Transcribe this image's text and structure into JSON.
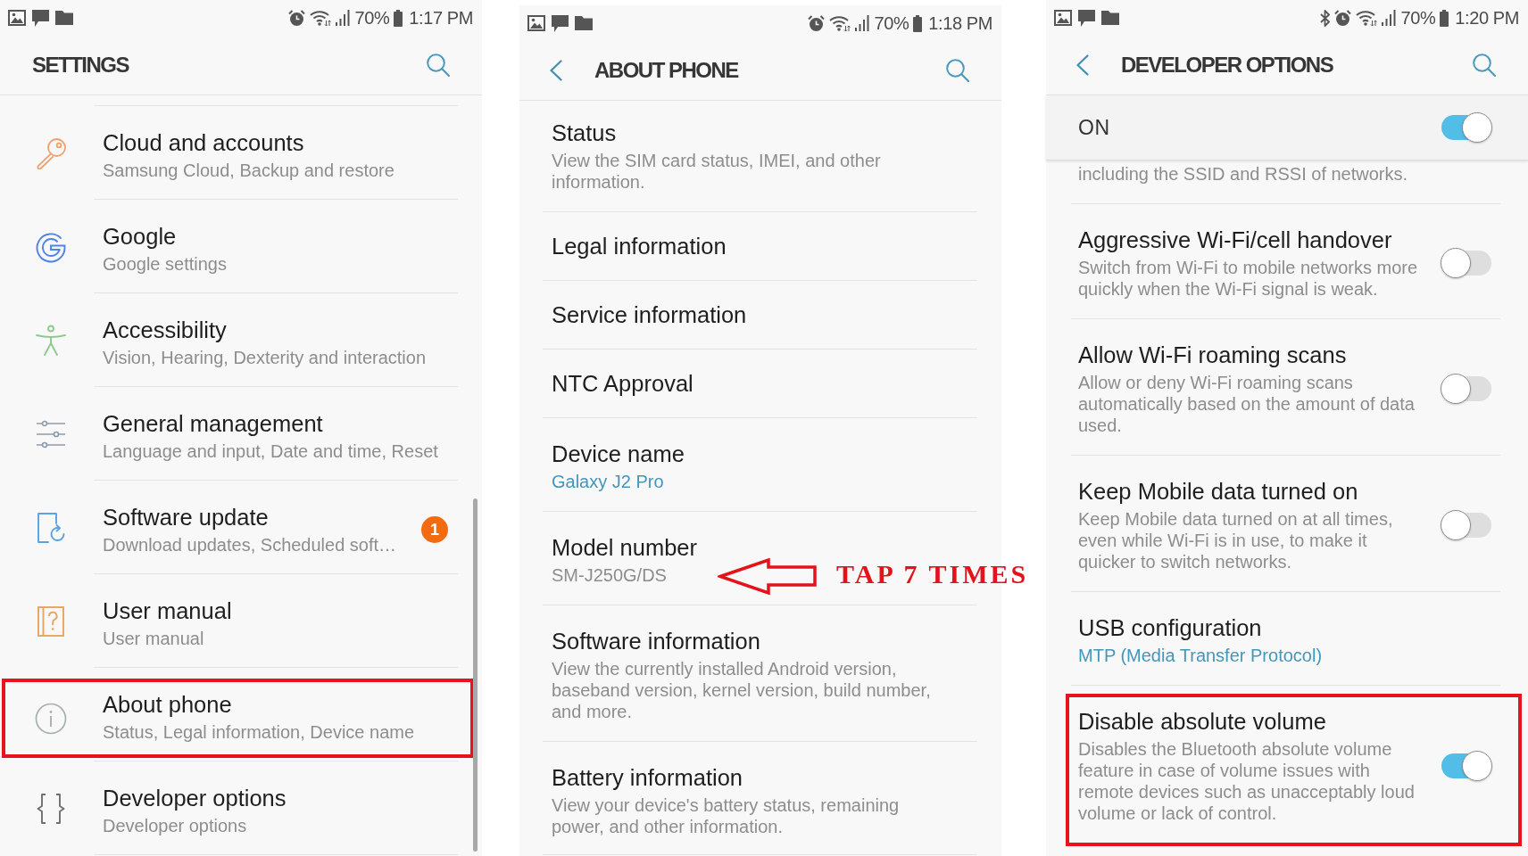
{
  "screens": [
    {
      "kind": "menu",
      "status_bar": {
        "bluetooth": false,
        "battery": "70%",
        "time": "1:17 PM"
      },
      "header": {
        "title": "SETTINGS",
        "back": false
      },
      "items": [
        {
          "title": "Cloud and accounts",
          "subtitle": "Samsung Cloud, Backup and restore",
          "highlighted": false
        },
        {
          "title": "Google",
          "subtitle": "Google settings",
          "highlighted": false
        },
        {
          "title": "Accessibility",
          "subtitle": "Vision, Hearing, Dexterity and interaction",
          "highlighted": false
        },
        {
          "title": "General management",
          "subtitle": "Language and input, Date and time, Reset",
          "highlighted": false
        },
        {
          "title": "Software update",
          "subtitle": "Download updates, Scheduled soft…",
          "badge": "1",
          "highlighted": false
        },
        {
          "title": "User manual",
          "subtitle": "User manual",
          "highlighted": false
        },
        {
          "title": "About phone",
          "subtitle": "Status, Legal information, Device name",
          "highlighted": true
        },
        {
          "title": "Developer options",
          "subtitle": "Developer options",
          "highlighted": false
        }
      ]
    },
    {
      "kind": "info",
      "status_bar": {
        "bluetooth": false,
        "battery": "70%",
        "time": "1:18 PM"
      },
      "header": {
        "title": "ABOUT PHONE",
        "back": true
      },
      "items": [
        {
          "title": "Status",
          "subtitle": "View the SIM card status, IMEI, and other information."
        },
        {
          "title": "Legal information"
        },
        {
          "title": "Service information"
        },
        {
          "title": "NTC Approval"
        },
        {
          "title": "Device name",
          "value": "Galaxy J2 Pro"
        },
        {
          "title": "Model number",
          "subtitle": "SM-J250G/DS",
          "annotation": "TAP 7 TIMES"
        },
        {
          "title": "Software information",
          "subtitle": "View the currently installed Android version, baseband version, kernel version, build number, and more."
        },
        {
          "title": "Battery information",
          "subtitle": "View your device's battery status, remaining power, and other information."
        }
      ]
    },
    {
      "kind": "options",
      "status_bar": {
        "bluetooth": true,
        "battery": "70%",
        "time": "1:20 PM"
      },
      "header": {
        "title": "DEVELOPER OPTIONS",
        "back": true
      },
      "master_switch": {
        "label": "ON",
        "on": true
      },
      "items": [
        {
          "kind": "fragment",
          "subtitle": "including the SSID and RSSI of networks.",
          "highlighted": false
        },
        {
          "kind": "switch",
          "title": "Aggressive Wi-Fi/cell handover",
          "subtitle": "Switch from Wi-Fi to mobile networks more quickly when the Wi-Fi signal is weak.",
          "on": false,
          "highlighted": false
        },
        {
          "kind": "switch",
          "title": "Allow Wi-Fi roaming scans",
          "subtitle": "Allow or deny Wi-Fi roaming scans automatically based on the amount of data used.",
          "on": false,
          "highlighted": false
        },
        {
          "kind": "switch",
          "title": "Keep Mobile data turned on",
          "subtitle": "Keep Mobile data turned on at all times, even while Wi-Fi is in use, to make it quicker to switch networks.",
          "on": false,
          "highlighted": false
        },
        {
          "kind": "value",
          "title": "USB configuration",
          "value": "MTP (Media Transfer Protocol)",
          "highlighted": false
        },
        {
          "kind": "switch",
          "title": "Disable absolute volume",
          "subtitle": "Disables the Bluetooth absolute volume feature in case of volume issues with remote devices such as unacceptably loud volume or lack of control.",
          "on": true,
          "highlighted": true
        }
      ]
    }
  ]
}
